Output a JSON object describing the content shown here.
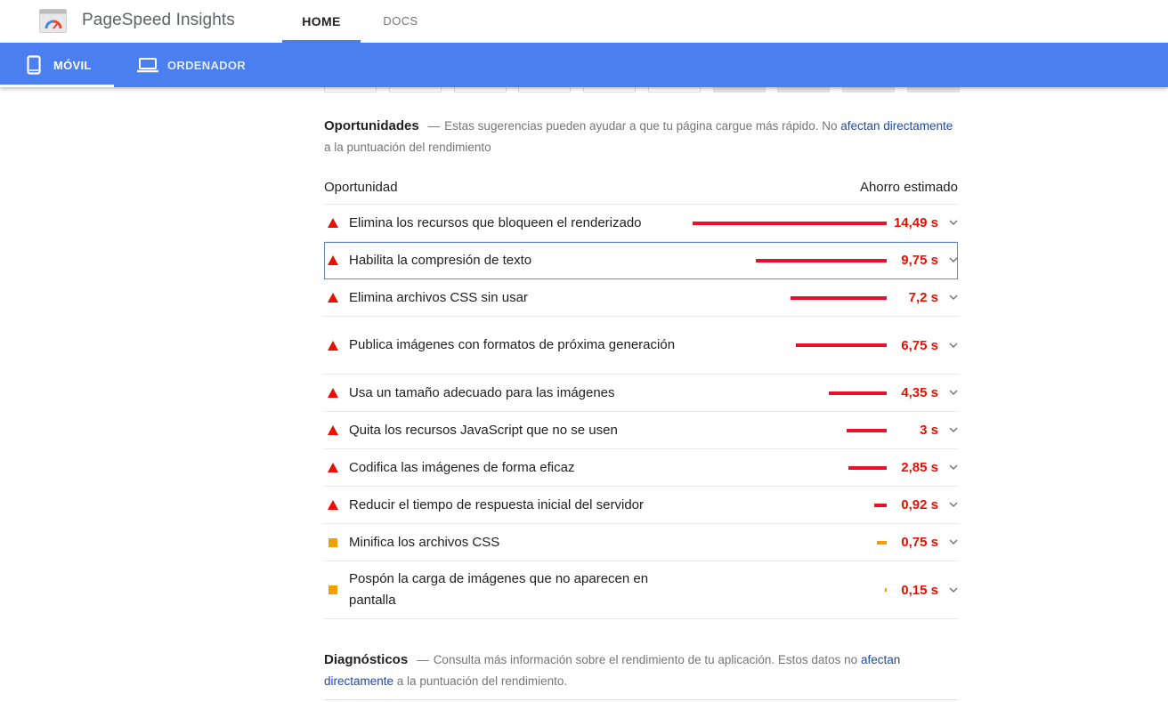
{
  "header": {
    "brand": "PageSpeed Insights",
    "tabs": [
      {
        "label": "HOME",
        "active": true
      },
      {
        "label": "DOCS",
        "active": false
      }
    ]
  },
  "device_tabs": [
    {
      "label": "MÓVIL",
      "icon": "phone-icon",
      "active": true
    },
    {
      "label": "ORDENADOR",
      "icon": "laptop-icon",
      "active": false
    }
  ],
  "opportunities": {
    "title": "Oportunidades",
    "desc_prefix": "Estas sugerencias pueden ayudar a que tu página cargue más rápido. No ",
    "desc_link": "afectan directamente",
    "desc_suffix": " a la puntuación del rendimiento",
    "col_left": "Oportunidad",
    "col_right": "Ahorro estimado",
    "items": [
      {
        "title": "Elimina los recursos que bloqueen el renderizado",
        "savings": "14,49 s",
        "seconds": 14.49,
        "severity": "fail"
      },
      {
        "title": "Habilita la compresión de texto",
        "savings": "9,75 s",
        "seconds": 9.75,
        "severity": "fail"
      },
      {
        "title": "Elimina archivos CSS sin usar",
        "savings": "7,2 s",
        "seconds": 7.2,
        "severity": "fail"
      },
      {
        "title": "Publica imágenes con formatos de próxima generación",
        "savings": "6,75 s",
        "seconds": 6.75,
        "severity": "fail"
      },
      {
        "title": "Usa un tamaño adecuado para las imágenes",
        "savings": "4,35 s",
        "seconds": 4.35,
        "severity": "fail"
      },
      {
        "title": "Quita los recursos JavaScript que no se usen",
        "savings": "3 s",
        "seconds": 3,
        "severity": "fail"
      },
      {
        "title": "Codifica las imágenes de forma eficaz",
        "savings": "2,85 s",
        "seconds": 2.85,
        "severity": "fail"
      },
      {
        "title": "Reducir el tiempo de respuesta inicial del servidor",
        "savings": "0,92 s",
        "seconds": 0.92,
        "severity": "fail"
      },
      {
        "title": "Minifica los archivos CSS",
        "savings": "0,75 s",
        "seconds": 0.75,
        "severity": "average"
      },
      {
        "title": "Pospón la carga de imágenes que no aparecen en pantalla",
        "savings": "0,15 s",
        "seconds": 0.15,
        "severity": "average"
      }
    ]
  },
  "diagnostics": {
    "title": "Diagnósticos",
    "desc_prefix": "Consulta más información sobre el rendimiento de tu aplicación. Estos datos no ",
    "desc_link": "afectan directamente",
    "desc_suffix": " a la puntuación del rendimiento."
  },
  "colors": {
    "device_bar": "#4b7ff0",
    "fail": "#eb0f00",
    "average": "#f2a000",
    "link": "#1a49b0"
  }
}
